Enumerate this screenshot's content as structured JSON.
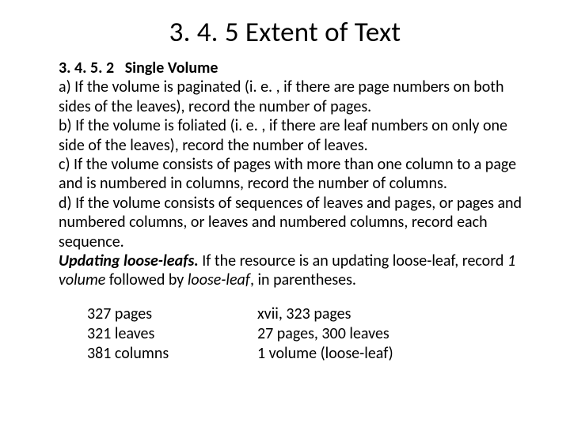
{
  "title": "3. 4. 5  Extent of Text",
  "subNumber": "3. 4. 5. 2",
  "subTitle": "Single Volume",
  "items": {
    "a": "a)  If the volume is paginated (i. e. , if there are page numbers on both sides of the leaves), record the number of pages.",
    "b": "b)  If the volume is foliated (i. e. , if there are leaf numbers on only one side of the leaves), record the number of leaves.",
    "c": "c)  If the volume consists of pages with more than one column to a page and is numbered in columns, record the number of columns.",
    "d": "d)  If the volume consists of sequences of leaves and pages, or pages and numbered columns, or leaves and numbered columns, record each sequence."
  },
  "looseleaf": {
    "lead": "Updating loose-leafs.",
    "mid1": " If the resource is an updating loose-leaf, record ",
    "vol": "1 volume",
    "mid2": " followed by ",
    "ll": "loose-leaf",
    "tail": ", in parentheses."
  },
  "examples": {
    "left": [
      "327 pages",
      "321 leaves",
      "381 columns"
    ],
    "right": [
      "xvii, 323 pages",
      "27 pages, 300 leaves",
      "1 volume (loose-leaf)"
    ]
  }
}
